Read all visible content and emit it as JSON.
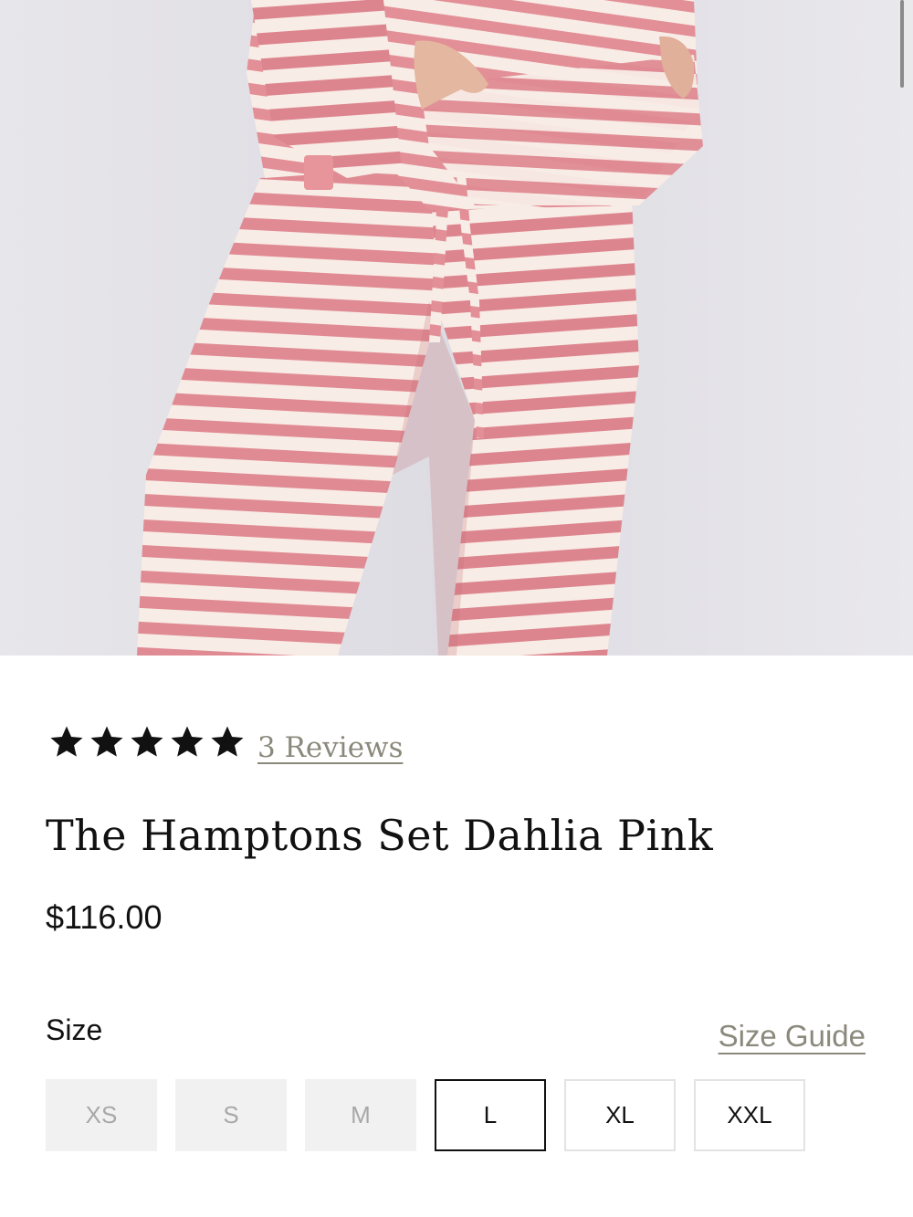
{
  "product": {
    "title": "The Hamptons Set Dahlia Pink",
    "price": "$116.00",
    "rating": 5,
    "reviews_link": "3 Reviews",
    "image_alt": "pink and white striped lounge set"
  },
  "size_section": {
    "label": "Size",
    "guide_link": "Size Guide",
    "options": [
      {
        "label": "XS",
        "state": "unavailable"
      },
      {
        "label": "S",
        "state": "unavailable"
      },
      {
        "label": "M",
        "state": "unavailable"
      },
      {
        "label": "L",
        "state": "selected"
      },
      {
        "label": "XL",
        "state": "available"
      },
      {
        "label": "XXL",
        "state": "available"
      }
    ]
  },
  "colors": {
    "accent_link": "#8b897c",
    "stripe_pink": "#e08b93",
    "stripe_cream": "#f8ece6",
    "photo_background": "#e4e3e8"
  },
  "icons": {
    "star": "star-filled-icon"
  }
}
